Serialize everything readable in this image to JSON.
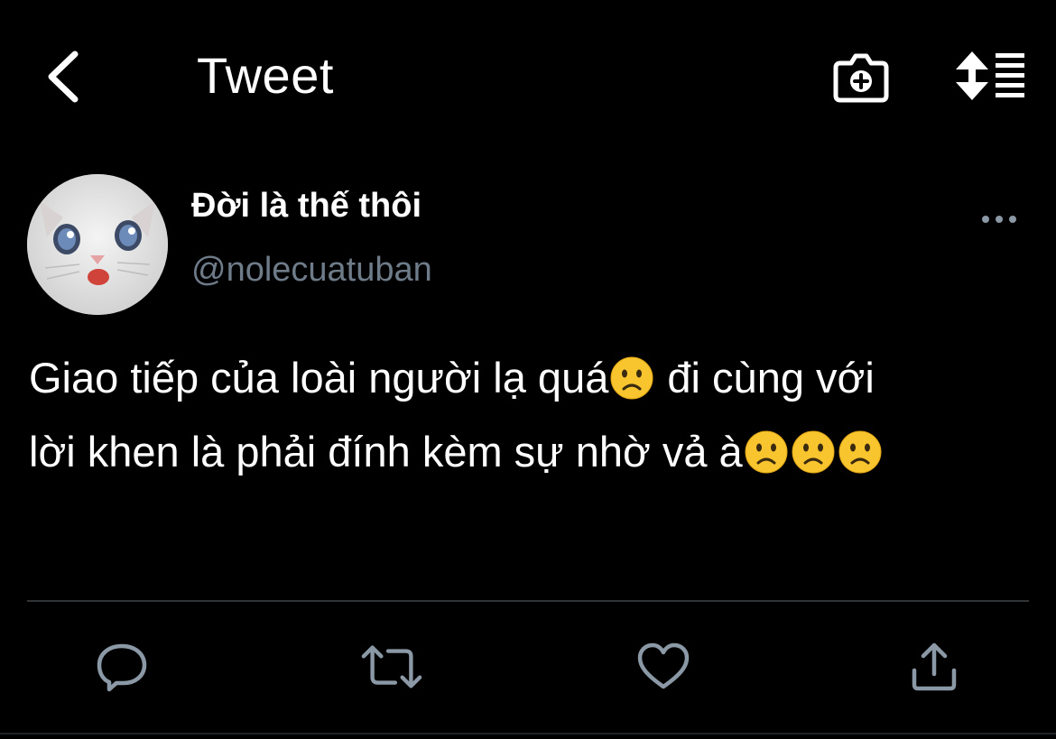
{
  "header": {
    "title": "Tweet",
    "back_icon": "chevron-left-icon",
    "camera_icon": "camera-plus-icon",
    "sort_icon": "sort-list-icon"
  },
  "tweet": {
    "display_name": "Đời là thế thôi",
    "handle": "@nolecuatuban",
    "text_line1": "Giao tiếp của loài người lạ quá",
    "text_line1_rest": " đi cùng với",
    "text_line2": "lời khen là phải đính kèm sự nhờ vả à",
    "emoji": "slightly-frowning-face"
  },
  "actions": {
    "reply_icon": "reply-icon",
    "retweet_icon": "retweet-icon",
    "like_icon": "heart-icon",
    "share_icon": "share-icon"
  },
  "colors": {
    "background": "#000000",
    "text": "#ffffff",
    "secondary": "#6e7b88",
    "icon": "#8b98a5",
    "divider": "#2f3336"
  }
}
